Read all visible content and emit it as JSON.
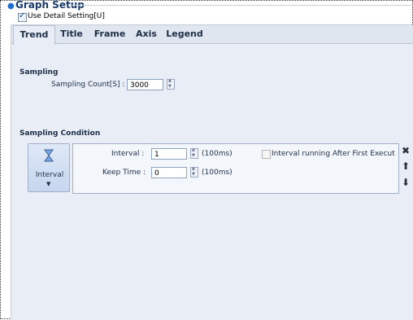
{
  "graph_setup": {
    "title": "Graph Setup",
    "detail_setting_label": "Use Detail Setting[U]",
    "detail_setting_checked": true
  },
  "tabs": [
    {
      "label": "Trend",
      "active": true
    },
    {
      "label": "Title",
      "active": false
    },
    {
      "label": "Frame",
      "active": false
    },
    {
      "label": "Axis",
      "active": false
    },
    {
      "label": "Legend",
      "active": false
    }
  ],
  "sampling": {
    "section_title": "Sampling",
    "count_label": "Sampling Count[S] :",
    "count_value": "3000"
  },
  "sampling_condition": {
    "section_title": "Sampling Condition",
    "interval_button_label": "Interval",
    "interval_label": "Interval :",
    "interval_value": "1",
    "interval_unit": "(100ms)",
    "keep_time_label": "Keep Time :",
    "keep_time_value": "0",
    "keep_time_unit": "(100ms)",
    "running_after_label": "Interval running After First Execute",
    "running_after_checked": false
  },
  "side_actions": {
    "delete_icon": "close-icon",
    "up_icon": "arrow-up-icon",
    "down_icon": "arrow-down-icon"
  },
  "colors": {
    "accent": "#1f6fd1",
    "panel_bg": "#e9eef6"
  }
}
